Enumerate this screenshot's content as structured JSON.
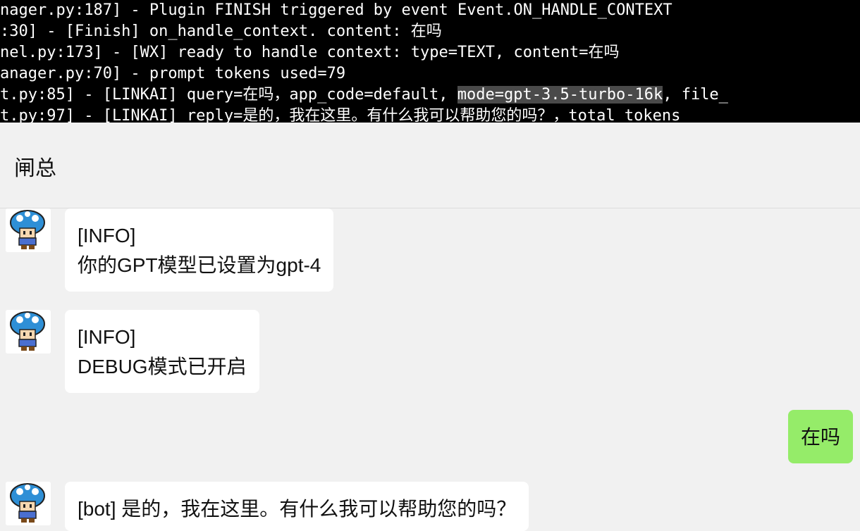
{
  "terminal": {
    "lines": [
      "nager.py:187] - Plugin FINISH triggered by event Event.ON_HANDLE_CONTEXT",
      ":30] - [Finish] on_handle_context. content: 在吗",
      "nel.py:173] - [WX] ready to handle context: type=TEXT, content=在吗",
      "anager.py:70] - prompt tokens used=79",
      "t.py:97] - [LINKAI] reply=是的，我在这里。有什么我可以帮助您的吗？，total tokens"
    ],
    "line5": {
      "prefix": "t.py:85] - [LINKAI] query=在吗，app_code=default, ",
      "highlight": "mode=gpt-3.5-turbo-16k",
      "suffix": ", file_"
    }
  },
  "chat": {
    "title": "闸总",
    "messages": [
      {
        "line1": "[INFO]",
        "line2": "你的GPT模型已设置为gpt-4"
      },
      {
        "line1": "[INFO]",
        "line2": "DEBUG模式已开启"
      },
      {
        "self": "在吗"
      },
      {
        "line1": "[bot] 是的，我在这里。有什么我可以帮助您的吗？"
      }
    ]
  }
}
